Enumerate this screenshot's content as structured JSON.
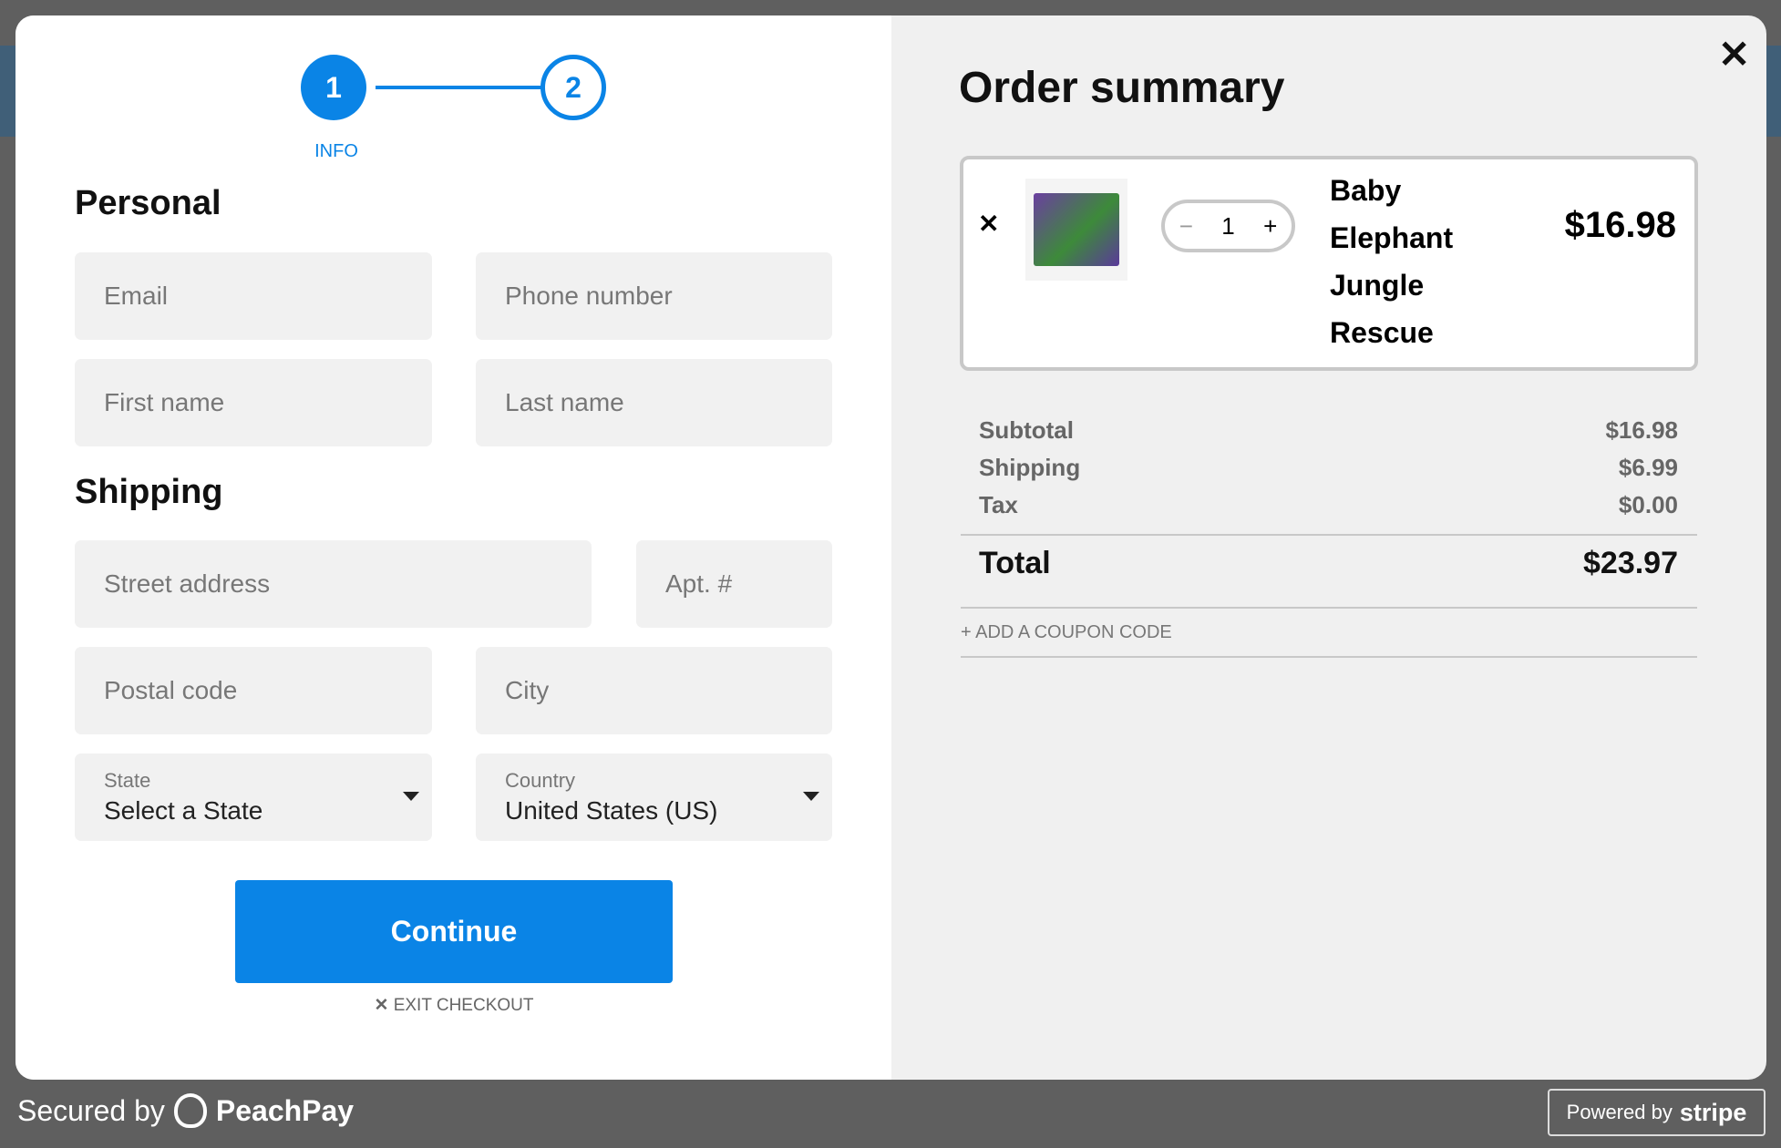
{
  "stepper": {
    "steps": [
      {
        "number": "1",
        "label": "INFO",
        "active": true
      },
      {
        "number": "2"
      }
    ],
    "accent": "#0a84e6"
  },
  "personal": {
    "title": "Personal",
    "email_placeholder": "Email",
    "phone_placeholder": "Phone number",
    "first_placeholder": "First name",
    "last_placeholder": "Last name"
  },
  "shipping": {
    "title": "Shipping",
    "street_placeholder": "Street address",
    "apt_placeholder": "Apt. #",
    "postal_placeholder": "Postal code",
    "city_placeholder": "City",
    "state_label": "State",
    "state_value": "Select a State",
    "country_label": "Country",
    "country_value": "United States (US)"
  },
  "actions": {
    "continue": "Continue",
    "exit": "EXIT CHECKOUT"
  },
  "summary": {
    "title": "Order summary",
    "item": {
      "name_lines": [
        "Baby",
        "Elephant",
        "Jungle",
        "Rescue"
      ],
      "quantity": "1",
      "price": "$16.98"
    },
    "rows": [
      {
        "label": "Subtotal",
        "value": "$16.98"
      },
      {
        "label": "Shipping",
        "value": "$6.99"
      },
      {
        "label": "Tax",
        "value": "$0.00"
      }
    ],
    "total_label": "Total",
    "total_value": "$23.97",
    "coupon": "+ ADD A COUPON CODE"
  },
  "footer": {
    "secured_by": "Secured by",
    "brand": "PeachPay",
    "powered_by": "Powered by",
    "stripe": "stripe"
  }
}
